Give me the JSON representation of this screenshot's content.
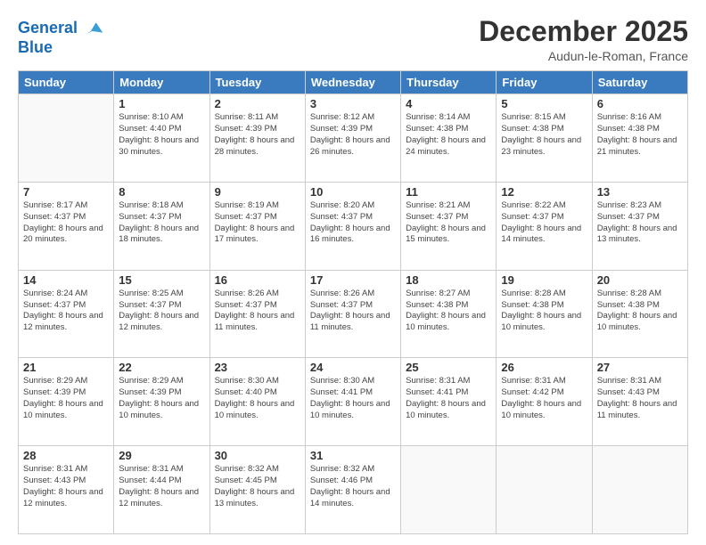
{
  "logo": {
    "line1": "General",
    "line2": "Blue"
  },
  "title": "December 2025",
  "subtitle": "Audun-le-Roman, France",
  "days_header": [
    "Sunday",
    "Monday",
    "Tuesday",
    "Wednesday",
    "Thursday",
    "Friday",
    "Saturday"
  ],
  "weeks": [
    [
      {
        "day": "",
        "sunrise": "",
        "sunset": "",
        "daylight": ""
      },
      {
        "day": "1",
        "sunrise": "Sunrise: 8:10 AM",
        "sunset": "Sunset: 4:40 PM",
        "daylight": "Daylight: 8 hours and 30 minutes."
      },
      {
        "day": "2",
        "sunrise": "Sunrise: 8:11 AM",
        "sunset": "Sunset: 4:39 PM",
        "daylight": "Daylight: 8 hours and 28 minutes."
      },
      {
        "day": "3",
        "sunrise": "Sunrise: 8:12 AM",
        "sunset": "Sunset: 4:39 PM",
        "daylight": "Daylight: 8 hours and 26 minutes."
      },
      {
        "day": "4",
        "sunrise": "Sunrise: 8:14 AM",
        "sunset": "Sunset: 4:38 PM",
        "daylight": "Daylight: 8 hours and 24 minutes."
      },
      {
        "day": "5",
        "sunrise": "Sunrise: 8:15 AM",
        "sunset": "Sunset: 4:38 PM",
        "daylight": "Daylight: 8 hours and 23 minutes."
      },
      {
        "day": "6",
        "sunrise": "Sunrise: 8:16 AM",
        "sunset": "Sunset: 4:38 PM",
        "daylight": "Daylight: 8 hours and 21 minutes."
      }
    ],
    [
      {
        "day": "7",
        "sunrise": "Sunrise: 8:17 AM",
        "sunset": "Sunset: 4:37 PM",
        "daylight": "Daylight: 8 hours and 20 minutes."
      },
      {
        "day": "8",
        "sunrise": "Sunrise: 8:18 AM",
        "sunset": "Sunset: 4:37 PM",
        "daylight": "Daylight: 8 hours and 18 minutes."
      },
      {
        "day": "9",
        "sunrise": "Sunrise: 8:19 AM",
        "sunset": "Sunset: 4:37 PM",
        "daylight": "Daylight: 8 hours and 17 minutes."
      },
      {
        "day": "10",
        "sunrise": "Sunrise: 8:20 AM",
        "sunset": "Sunset: 4:37 PM",
        "daylight": "Daylight: 8 hours and 16 minutes."
      },
      {
        "day": "11",
        "sunrise": "Sunrise: 8:21 AM",
        "sunset": "Sunset: 4:37 PM",
        "daylight": "Daylight: 8 hours and 15 minutes."
      },
      {
        "day": "12",
        "sunrise": "Sunrise: 8:22 AM",
        "sunset": "Sunset: 4:37 PM",
        "daylight": "Daylight: 8 hours and 14 minutes."
      },
      {
        "day": "13",
        "sunrise": "Sunrise: 8:23 AM",
        "sunset": "Sunset: 4:37 PM",
        "daylight": "Daylight: 8 hours and 13 minutes."
      }
    ],
    [
      {
        "day": "14",
        "sunrise": "Sunrise: 8:24 AM",
        "sunset": "Sunset: 4:37 PM",
        "daylight": "Daylight: 8 hours and 12 minutes."
      },
      {
        "day": "15",
        "sunrise": "Sunrise: 8:25 AM",
        "sunset": "Sunset: 4:37 PM",
        "daylight": "Daylight: 8 hours and 12 minutes."
      },
      {
        "day": "16",
        "sunrise": "Sunrise: 8:26 AM",
        "sunset": "Sunset: 4:37 PM",
        "daylight": "Daylight: 8 hours and 11 minutes."
      },
      {
        "day": "17",
        "sunrise": "Sunrise: 8:26 AM",
        "sunset": "Sunset: 4:37 PM",
        "daylight": "Daylight: 8 hours and 11 minutes."
      },
      {
        "day": "18",
        "sunrise": "Sunrise: 8:27 AM",
        "sunset": "Sunset: 4:38 PM",
        "daylight": "Daylight: 8 hours and 10 minutes."
      },
      {
        "day": "19",
        "sunrise": "Sunrise: 8:28 AM",
        "sunset": "Sunset: 4:38 PM",
        "daylight": "Daylight: 8 hours and 10 minutes."
      },
      {
        "day": "20",
        "sunrise": "Sunrise: 8:28 AM",
        "sunset": "Sunset: 4:38 PM",
        "daylight": "Daylight: 8 hours and 10 minutes."
      }
    ],
    [
      {
        "day": "21",
        "sunrise": "Sunrise: 8:29 AM",
        "sunset": "Sunset: 4:39 PM",
        "daylight": "Daylight: 8 hours and 10 minutes."
      },
      {
        "day": "22",
        "sunrise": "Sunrise: 8:29 AM",
        "sunset": "Sunset: 4:39 PM",
        "daylight": "Daylight: 8 hours and 10 minutes."
      },
      {
        "day": "23",
        "sunrise": "Sunrise: 8:30 AM",
        "sunset": "Sunset: 4:40 PM",
        "daylight": "Daylight: 8 hours and 10 minutes."
      },
      {
        "day": "24",
        "sunrise": "Sunrise: 8:30 AM",
        "sunset": "Sunset: 4:41 PM",
        "daylight": "Daylight: 8 hours and 10 minutes."
      },
      {
        "day": "25",
        "sunrise": "Sunrise: 8:31 AM",
        "sunset": "Sunset: 4:41 PM",
        "daylight": "Daylight: 8 hours and 10 minutes."
      },
      {
        "day": "26",
        "sunrise": "Sunrise: 8:31 AM",
        "sunset": "Sunset: 4:42 PM",
        "daylight": "Daylight: 8 hours and 10 minutes."
      },
      {
        "day": "27",
        "sunrise": "Sunrise: 8:31 AM",
        "sunset": "Sunset: 4:43 PM",
        "daylight": "Daylight: 8 hours and 11 minutes."
      }
    ],
    [
      {
        "day": "28",
        "sunrise": "Sunrise: 8:31 AM",
        "sunset": "Sunset: 4:43 PM",
        "daylight": "Daylight: 8 hours and 12 minutes."
      },
      {
        "day": "29",
        "sunrise": "Sunrise: 8:31 AM",
        "sunset": "Sunset: 4:44 PM",
        "daylight": "Daylight: 8 hours and 12 minutes."
      },
      {
        "day": "30",
        "sunrise": "Sunrise: 8:32 AM",
        "sunset": "Sunset: 4:45 PM",
        "daylight": "Daylight: 8 hours and 13 minutes."
      },
      {
        "day": "31",
        "sunrise": "Sunrise: 8:32 AM",
        "sunset": "Sunset: 4:46 PM",
        "daylight": "Daylight: 8 hours and 14 minutes."
      },
      {
        "day": "",
        "sunrise": "",
        "sunset": "",
        "daylight": ""
      },
      {
        "day": "",
        "sunrise": "",
        "sunset": "",
        "daylight": ""
      },
      {
        "day": "",
        "sunrise": "",
        "sunset": "",
        "daylight": ""
      }
    ]
  ]
}
